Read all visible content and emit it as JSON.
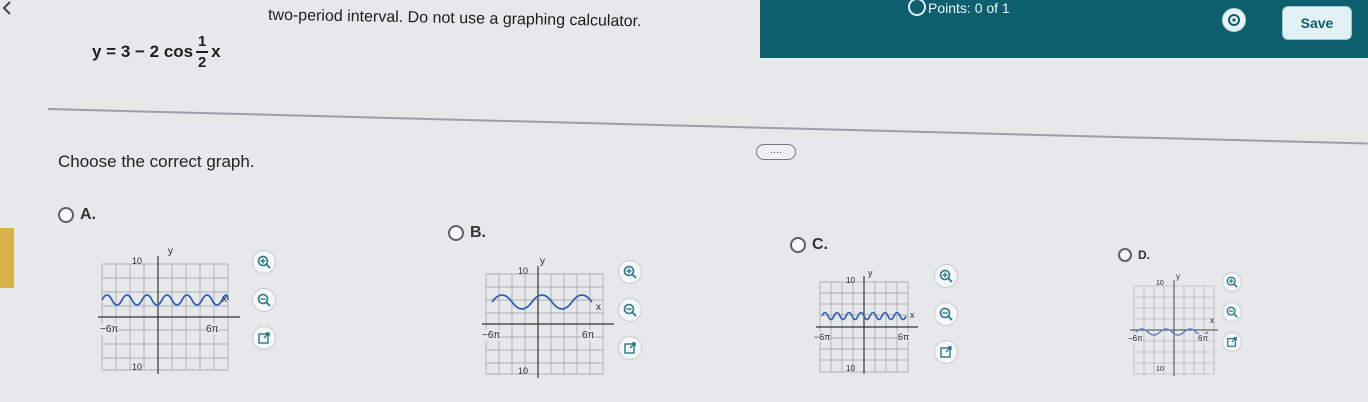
{
  "header": {
    "instruction": "two-period interval. Do not use a graphing calculator.",
    "points": "Points: 0 of 1",
    "save_label": "Save"
  },
  "question": {
    "eq_left": "y = 3 − 2 cos",
    "frac_num": "1",
    "frac_den": "2",
    "eq_var": "x",
    "prompt": "Choose the correct graph.",
    "more_label": "····"
  },
  "options": [
    {
      "label": "A.",
      "y_top": "10",
      "y_bottom": "10",
      "x_left": "−6π",
      "x_right": "6π",
      "x_axis": "x",
      "y_axis": "y"
    },
    {
      "label": "B.",
      "y_top": "10",
      "y_bottom": "10",
      "x_left": "−6π",
      "x_right": "6π",
      "x_axis": "x",
      "y_axis": "y"
    },
    {
      "label": "C.",
      "y_top": "10",
      "y_bottom": "10",
      "x_left": "−6π",
      "x_right": "6π",
      "x_axis": "x",
      "y_axis": "y"
    },
    {
      "label": "D.",
      "y_top": "10",
      "y_bottom": "10",
      "x_left": "−6π",
      "x_right": "6π",
      "x_axis": "x",
      "y_axis": "y"
    }
  ],
  "icons": {
    "zoom_in": "zoom-in-icon",
    "zoom_out": "zoom-out-icon",
    "open": "open-external-icon",
    "gear": "gear-icon"
  },
  "colors": {
    "header": "#0e5f6e",
    "curve": "#2f5fb3",
    "grid": "#9aa0a6"
  }
}
